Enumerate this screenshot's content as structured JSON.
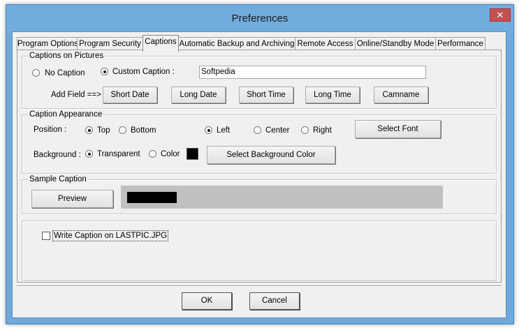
{
  "window": {
    "title": "Preferences",
    "close_glyph": "✕"
  },
  "tabs": [
    {
      "label": "Program Options"
    },
    {
      "label": "Program Security"
    },
    {
      "label": "Captions"
    },
    {
      "label": "Automatic Backup and Archiving"
    },
    {
      "label": "Remote Access"
    },
    {
      "label": "Online/Standby Mode"
    },
    {
      "label": "Performance"
    }
  ],
  "active_tab": "Captions",
  "captions_on_pictures": {
    "group_label": "Captions on Pictures",
    "no_caption_label": "No Caption",
    "custom_caption_label": "Custom Caption :",
    "selected": "custom",
    "custom_caption_value": "Softpedia",
    "add_field_label": "Add Field ==>",
    "field_buttons": [
      "Short Date",
      "Long Date",
      "Short Time",
      "Long Time",
      "Camname"
    ]
  },
  "caption_appearance": {
    "group_label": "Caption Appearance",
    "position_label": "Position :",
    "top_label": "Top",
    "bottom_label": "Bottom",
    "vertical_selected": "top",
    "left_label": "Left",
    "center_label": "Center",
    "right_label": "Right",
    "horizontal_selected": "left",
    "select_font_label": "Select Font",
    "background_label": "Background :",
    "transparent_label": "Transparent",
    "color_label": "Color",
    "background_selected": "transparent",
    "swatch_color": "#000000",
    "select_bg_color_label": "Select Background Color"
  },
  "sample_caption": {
    "group_label": "Sample Caption",
    "preview_label": "Preview",
    "preview_bg": "#c0c0c0",
    "caption_block_color": "#000000"
  },
  "write_caption": {
    "label": "Write Caption on LASTPIC.JPG",
    "checked": false
  },
  "footer": {
    "ok_label": "OK",
    "cancel_label": "Cancel"
  }
}
